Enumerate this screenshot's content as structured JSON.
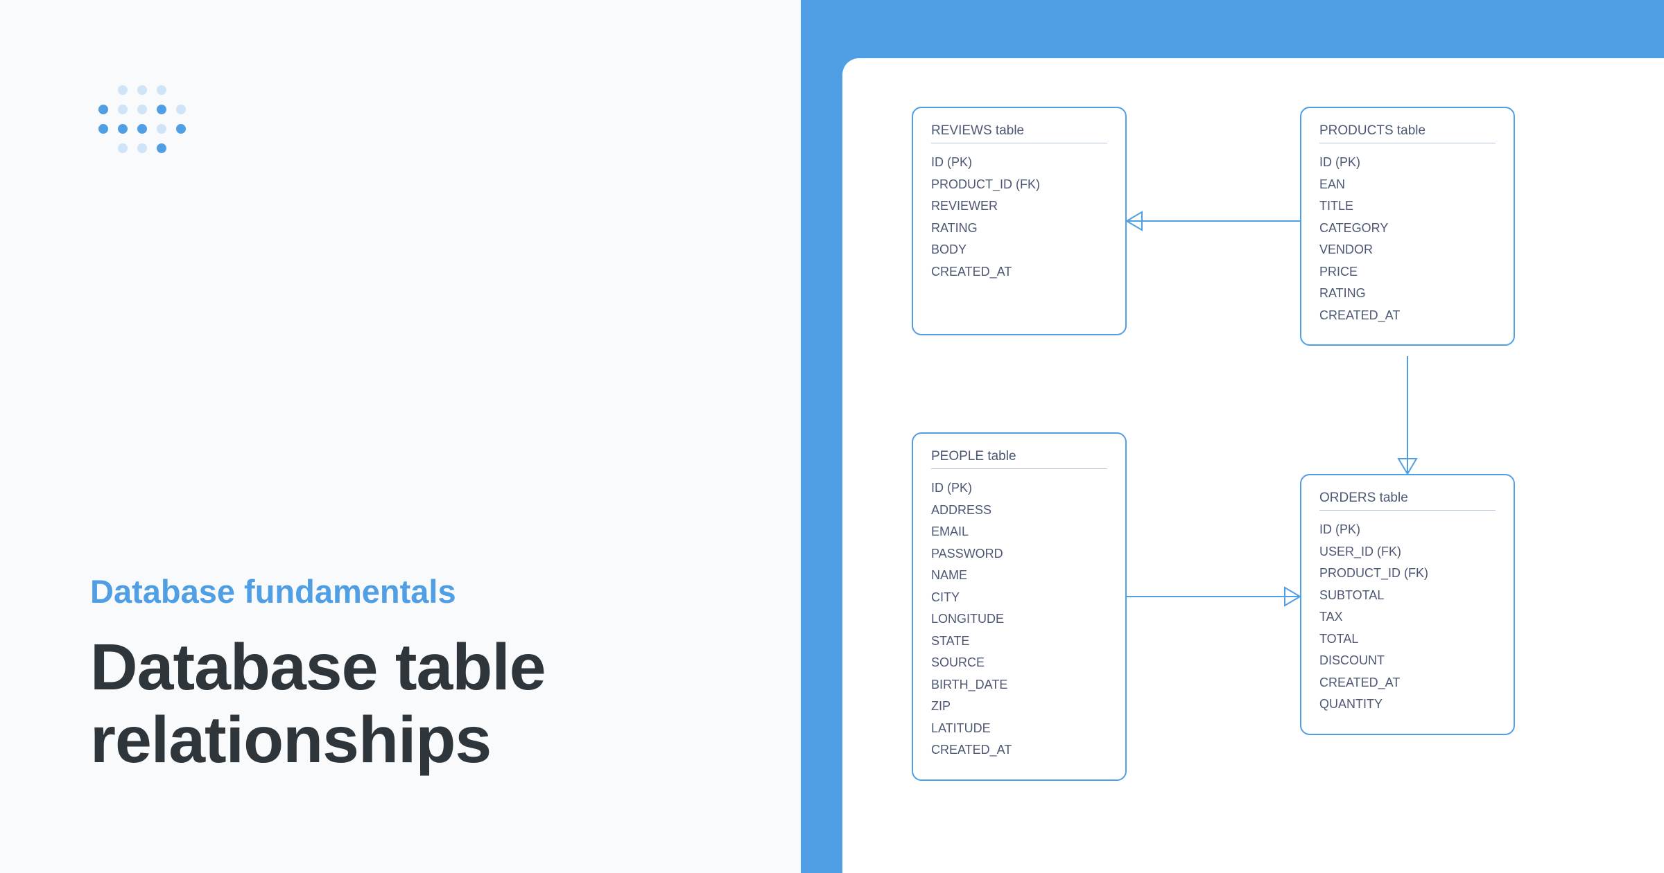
{
  "left": {
    "eyebrow": "Database fundamentals",
    "title": "Database table relationships"
  },
  "tables": {
    "reviews": {
      "title": "REVIEWS table",
      "cols": [
        "ID (PK)",
        "PRODUCT_ID (FK)",
        "REVIEWER",
        "RATING",
        "BODY",
        "CREATED_AT"
      ]
    },
    "products": {
      "title": "PRODUCTS table",
      "cols": [
        "ID (PK)",
        "EAN",
        "TITLE",
        "CATEGORY",
        "VENDOR",
        "PRICE",
        "RATING",
        "CREATED_AT"
      ]
    },
    "people": {
      "title": "PEOPLE table",
      "cols": [
        "ID (PK)",
        "ADDRESS",
        "EMAIL",
        "PASSWORD",
        "NAME",
        "CITY",
        "LONGITUDE",
        "STATE",
        "SOURCE",
        "BIRTH_DATE",
        "ZIP",
        "LATITUDE",
        "CREATED_AT"
      ]
    },
    "orders": {
      "title": "ORDERS table",
      "cols": [
        "ID (PK)",
        "USER_ID (FK)",
        "PRODUCT_ID (FK)",
        "SUBTOTAL",
        "TAX",
        "TOTAL",
        "DISCOUNT",
        "CREATED_AT",
        "QUANTITY"
      ]
    }
  },
  "colors": {
    "accent": "#509ee3",
    "text_dark": "#2e353b",
    "text_muted": "#4c5773",
    "left_bg": "#f9fafb"
  }
}
